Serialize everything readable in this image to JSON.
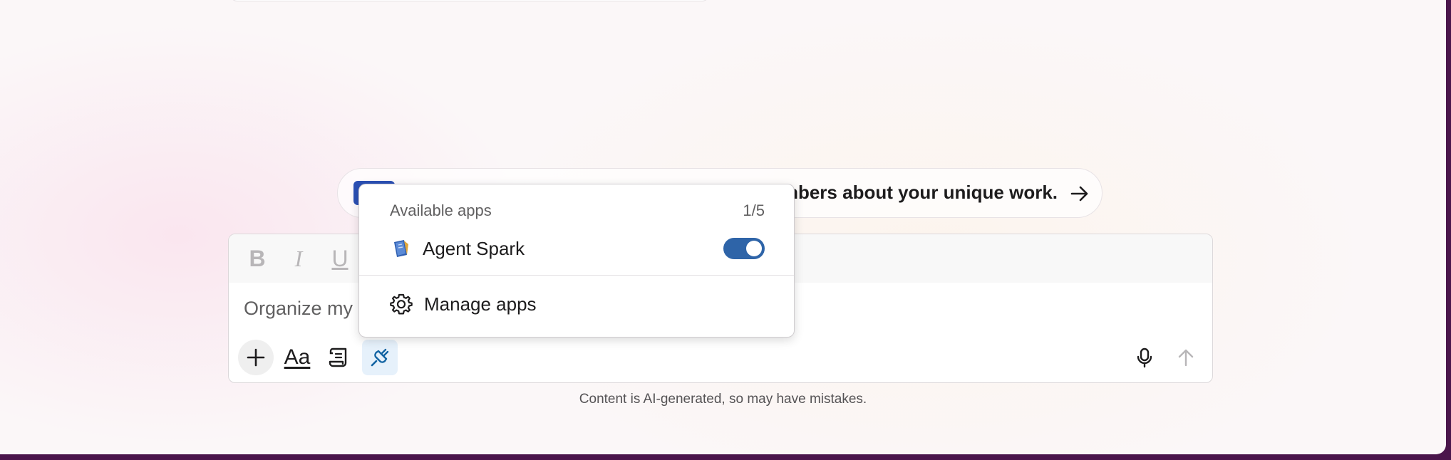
{
  "suggestion": {
    "text": "mbers about your unique work.",
    "arrow_icon": "arrow-right-icon"
  },
  "composer": {
    "format": {
      "bold": "B",
      "italic": "I",
      "underline": "U"
    },
    "text": "Organize my s",
    "tools": {
      "add": "plus-icon",
      "formatting_label": "Aa",
      "canvas": "scroll-icon",
      "apps": "plug-icon"
    },
    "mic": "microphone-icon",
    "send": "arrow-up-icon"
  },
  "disclaimer": "Content is AI-generated, so may have mistakes.",
  "apps_popup": {
    "title": "Available apps",
    "count": "1/5",
    "apps": [
      {
        "name": "Agent Spark",
        "enabled": true,
        "icon": "agent-spark-icon"
      }
    ],
    "manage_label": "Manage apps",
    "manage_icon": "gear-icon"
  },
  "colors": {
    "toggle_on": "#2e64a8",
    "window_frame": "#4a154b",
    "active_tool_bg": "#e6f1fb"
  }
}
